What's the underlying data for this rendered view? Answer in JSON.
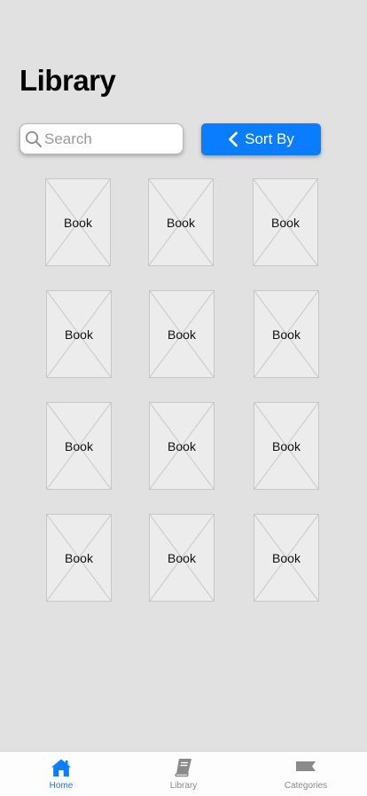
{
  "page": {
    "title": "Library"
  },
  "search": {
    "placeholder": "Search",
    "value": ""
  },
  "sort": {
    "label": "Sort By"
  },
  "books": [
    {
      "label": "Book"
    },
    {
      "label": "Book"
    },
    {
      "label": "Book"
    },
    {
      "label": "Book"
    },
    {
      "label": "Book"
    },
    {
      "label": "Book"
    },
    {
      "label": "Book"
    },
    {
      "label": "Book"
    },
    {
      "label": "Book"
    },
    {
      "label": "Book"
    },
    {
      "label": "Book"
    },
    {
      "label": "Book"
    }
  ],
  "tabbar": {
    "tabs": [
      {
        "label": "Home",
        "icon": "home-icon",
        "active": true
      },
      {
        "label": "Library",
        "icon": "book-icon",
        "active": false
      },
      {
        "label": "Categories",
        "icon": "flag-icon",
        "active": false
      }
    ]
  },
  "colors": {
    "accent": "#0a7dff",
    "background": "#e1e1e1",
    "inactive": "#8a8a8a"
  }
}
